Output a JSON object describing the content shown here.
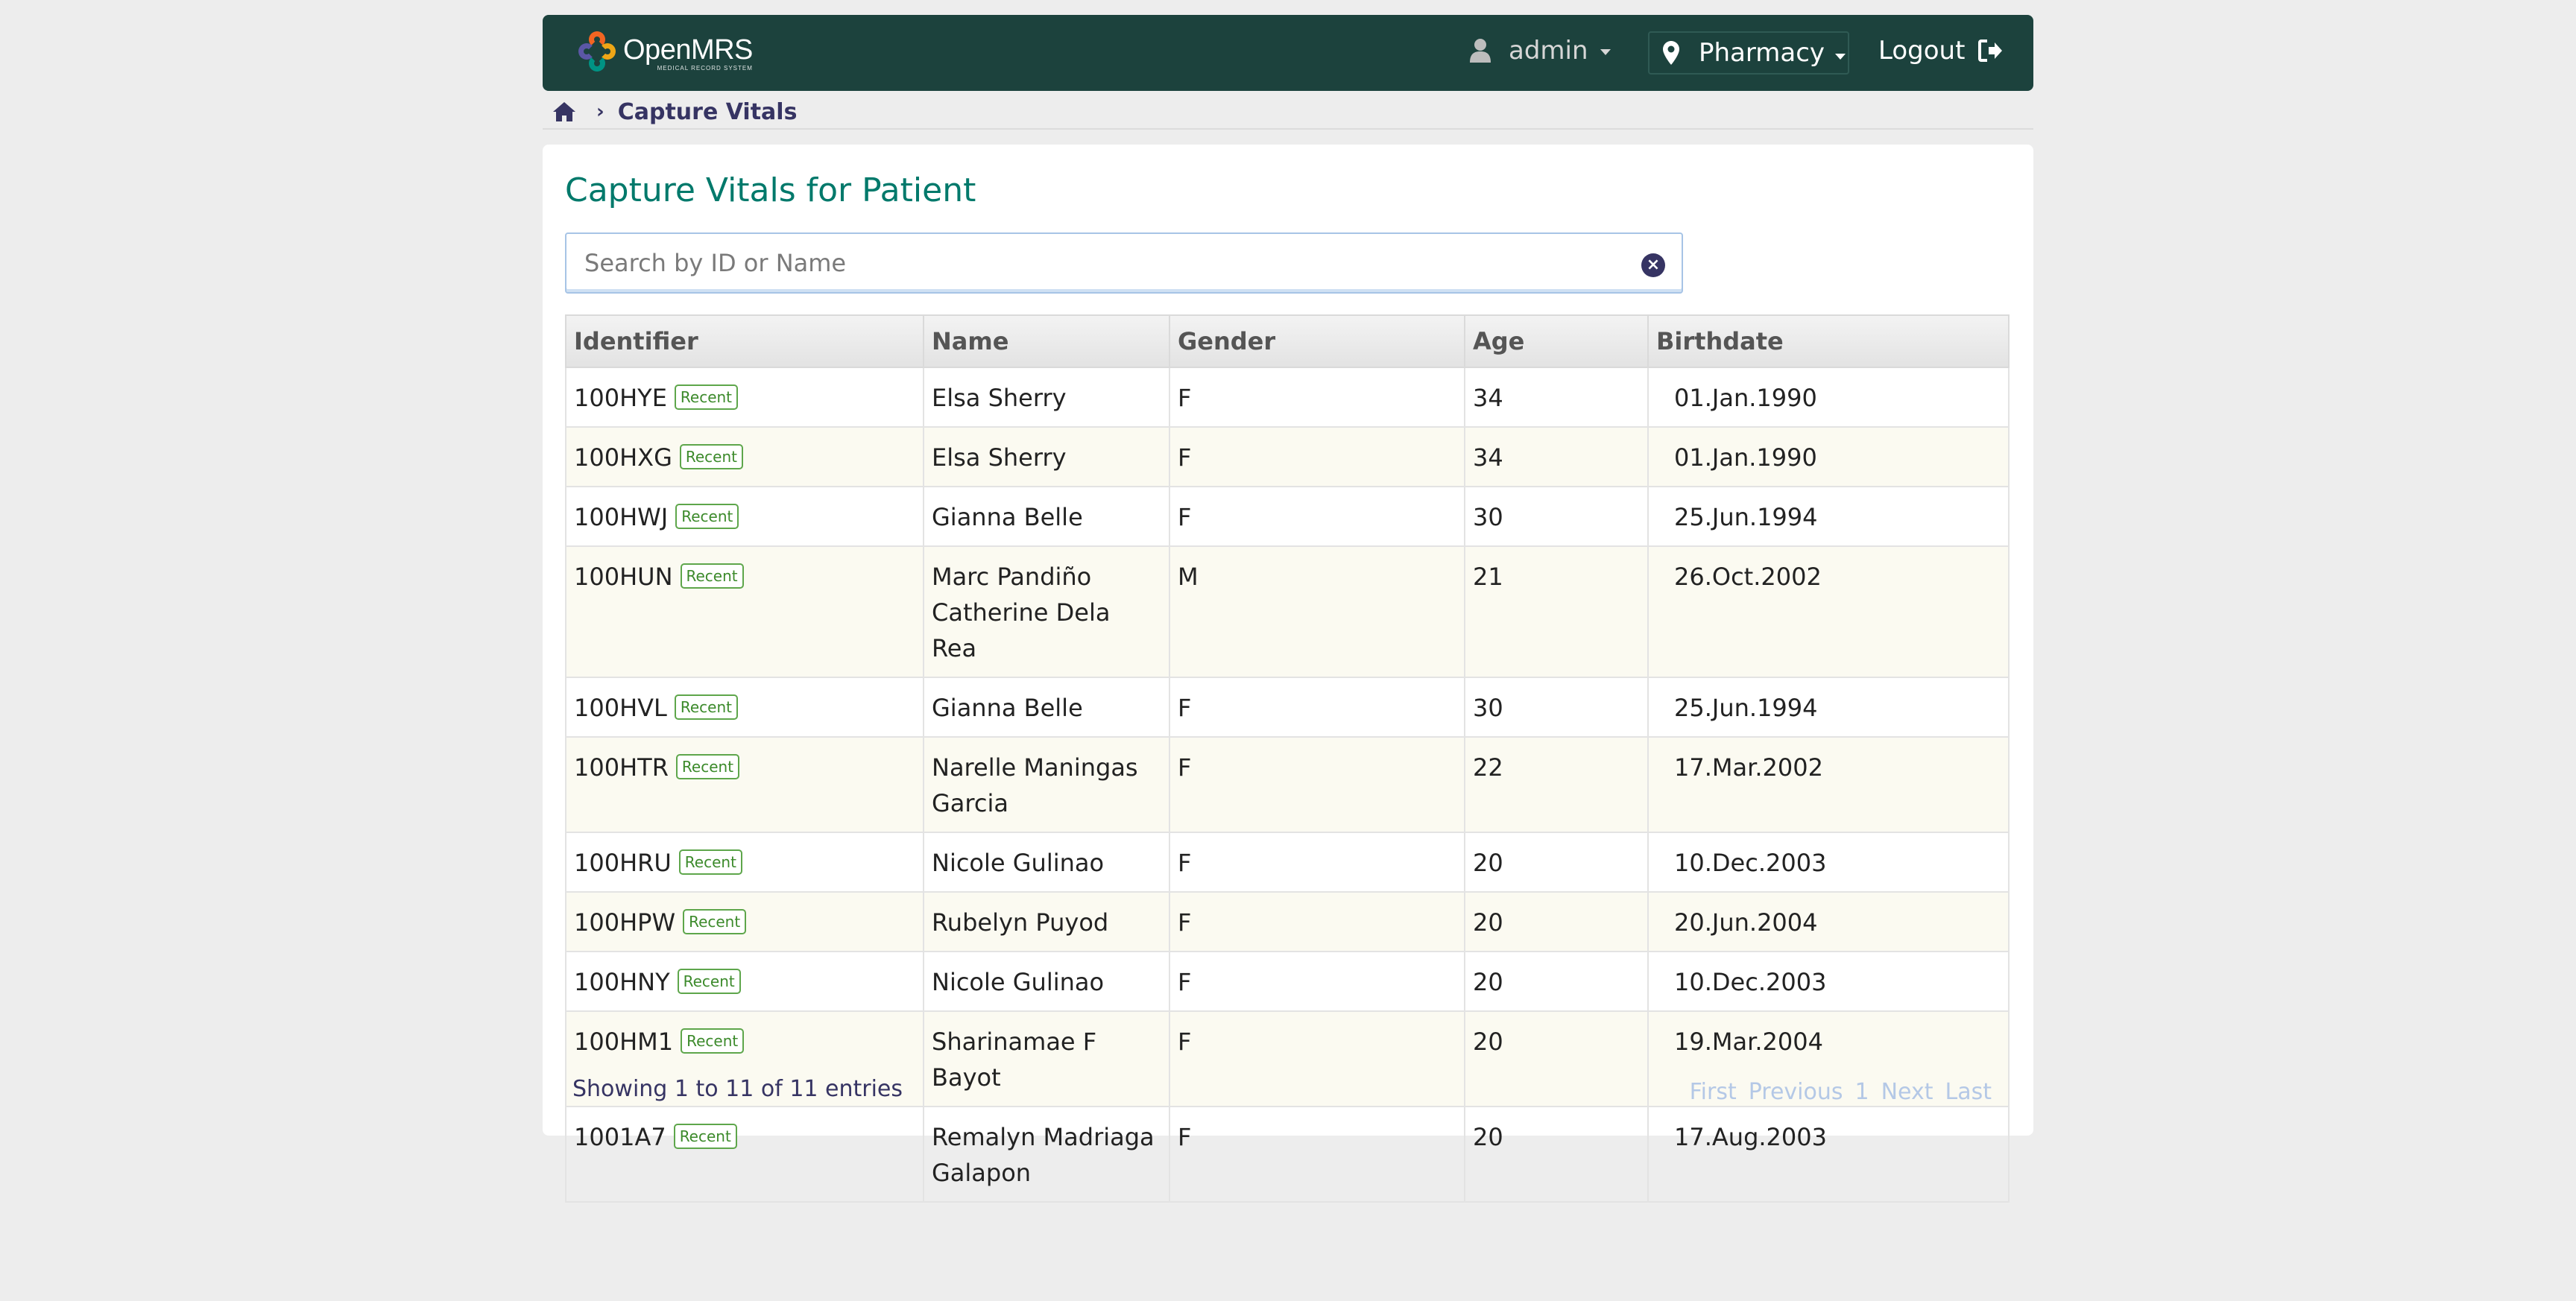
{
  "header": {
    "logo_name": "OpenMRS",
    "logo_sub": "MEDICAL RECORD SYSTEM",
    "user": "admin",
    "location": "Pharmacy",
    "logout": "Logout"
  },
  "breadcrumb": {
    "current": "Capture Vitals"
  },
  "page": {
    "title": "Capture Vitals for Patient",
    "search_placeholder": "Search by ID or Name"
  },
  "table": {
    "headers": [
      "Identifier",
      "Name",
      "Gender",
      "Age",
      "Birthdate"
    ],
    "badge": "Recent",
    "rows": [
      {
        "id": "100HYE",
        "name": "Elsa Sherry",
        "gender": "F",
        "age": "34",
        "birthdate": "01.Jan.1990"
      },
      {
        "id": "100HXG",
        "name": "Elsa Sherry",
        "gender": "F",
        "age": "34",
        "birthdate": "01.Jan.1990"
      },
      {
        "id": "100HWJ",
        "name": "Gianna Belle",
        "gender": "F",
        "age": "30",
        "birthdate": "25.Jun.1994"
      },
      {
        "id": "100HUN",
        "name": "Marc Pandiño Catherine Dela Rea",
        "gender": "M",
        "age": "21",
        "birthdate": "26.Oct.2002"
      },
      {
        "id": "100HVL",
        "name": "Gianna Belle",
        "gender": "F",
        "age": "30",
        "birthdate": "25.Jun.1994"
      },
      {
        "id": "100HTR",
        "name": "Narelle Maningas Garcia",
        "gender": "F",
        "age": "22",
        "birthdate": "17.Mar.2002"
      },
      {
        "id": "100HRU",
        "name": "Nicole Gulinao",
        "gender": "F",
        "age": "20",
        "birthdate": "10.Dec.2003"
      },
      {
        "id": "100HPW",
        "name": "Rubelyn Puyod",
        "gender": "F",
        "age": "20",
        "birthdate": "20.Jun.2004"
      },
      {
        "id": "100HNY",
        "name": "Nicole Gulinao",
        "gender": "F",
        "age": "20",
        "birthdate": "10.Dec.2003"
      },
      {
        "id": "100HM1",
        "name": "Sharinamae F Bayot",
        "gender": "F",
        "age": "20",
        "birthdate": "19.Mar.2004"
      },
      {
        "id": "1001A7",
        "name": "Remalyn Madriaga Galapon",
        "gender": "F",
        "age": "20",
        "birthdate": "17.Aug.2003"
      }
    ]
  },
  "footer": {
    "info": "Showing 1 to 11 of 11 entries",
    "pager": [
      "First",
      "Previous",
      "1",
      "Next",
      "Last"
    ]
  }
}
